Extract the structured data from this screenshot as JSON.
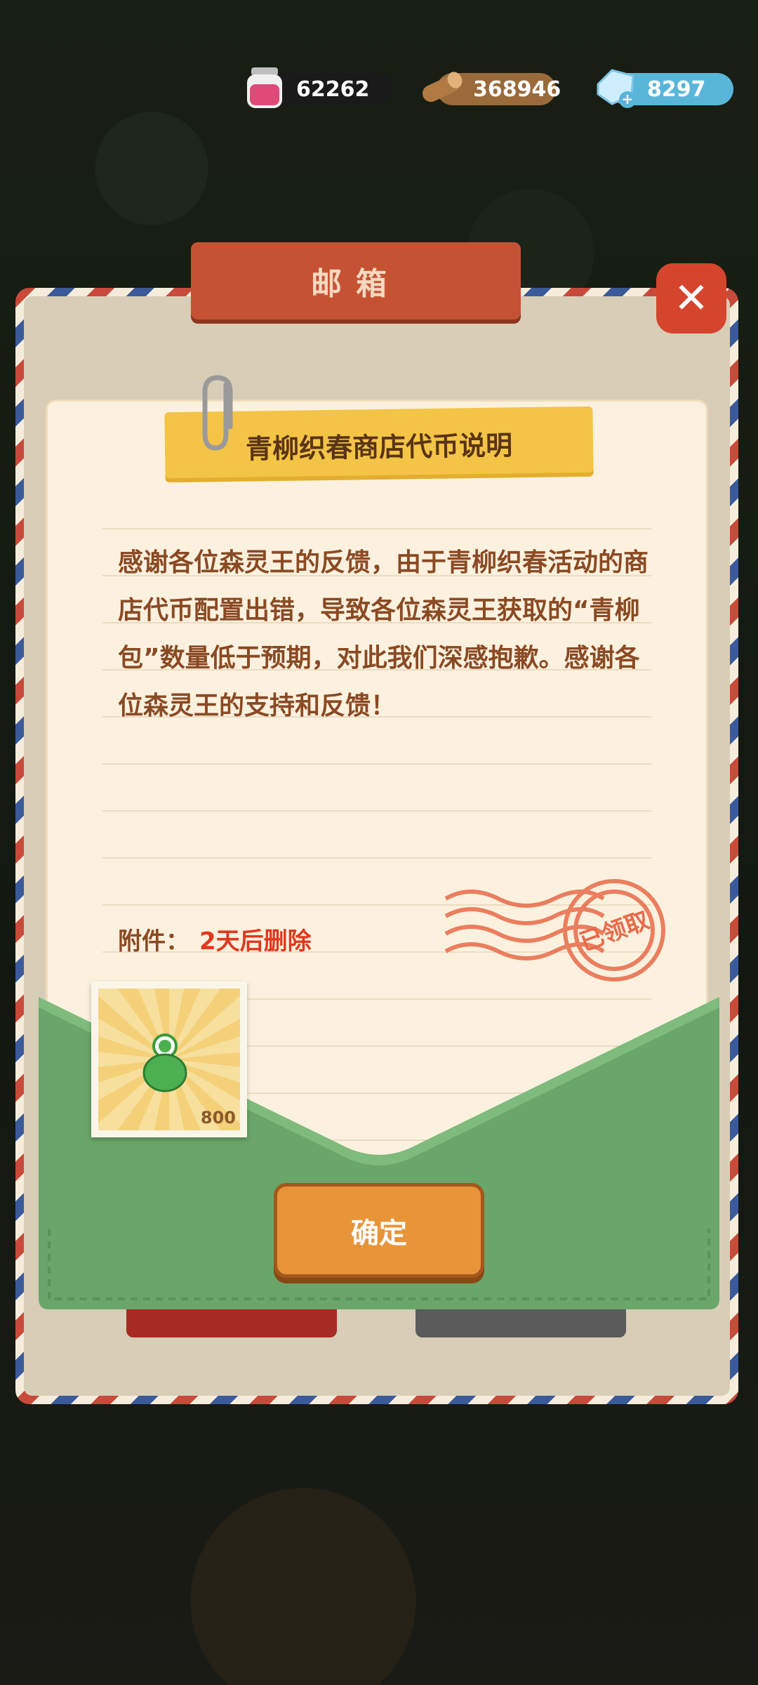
{
  "currencies": [
    {
      "icon": "jam-jar-icon",
      "value": "62262",
      "color": "#e04a7a"
    },
    {
      "icon": "wood-log-icon",
      "value": "368946",
      "color": "#a06a3a"
    },
    {
      "icon": "crystal-icon",
      "value": "8297",
      "color": "#5ab6d9"
    }
  ],
  "mailbox": {
    "title": "邮箱",
    "close_label": "✕"
  },
  "letter": {
    "title": "青柳织春商店代币说明",
    "body": "感谢各位森灵王的反馈，由于青柳织春活动的商店代币配置出错，导致各位森灵王获取的“青柳包”数量低于预期，对此我们深感抱歉。感谢各位森灵王的支持和反馈！",
    "attachment_label": "附件：",
    "delete_notice": "2天后删除",
    "stamp_text": "已领取",
    "item": {
      "icon": "green-bag-icon",
      "count": "800"
    },
    "confirm_label": "确定"
  },
  "colors": {
    "accent": "#e2371e",
    "text": "#8a4a24",
    "tape": "#f3c446",
    "envelope": "#6aa56a"
  }
}
